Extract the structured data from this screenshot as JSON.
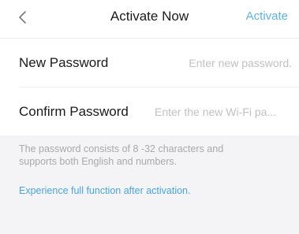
{
  "header": {
    "back_icon": "chevron-left-icon",
    "title": "Activate Now",
    "action_label": "Activate",
    "accent_color": "#5fb3e6"
  },
  "form": {
    "new_password": {
      "label": "New Password",
      "value": "",
      "placeholder": "Enter new password."
    },
    "confirm_password": {
      "label": "Confirm Password",
      "value": "",
      "placeholder": "Enter the new Wi-Fi pa..."
    }
  },
  "hint": {
    "text": "The password consists of 8 -32 characters and supports both English and numbers."
  },
  "link": {
    "text": "Experience full function after activation.",
    "color": "#4aa3df"
  }
}
